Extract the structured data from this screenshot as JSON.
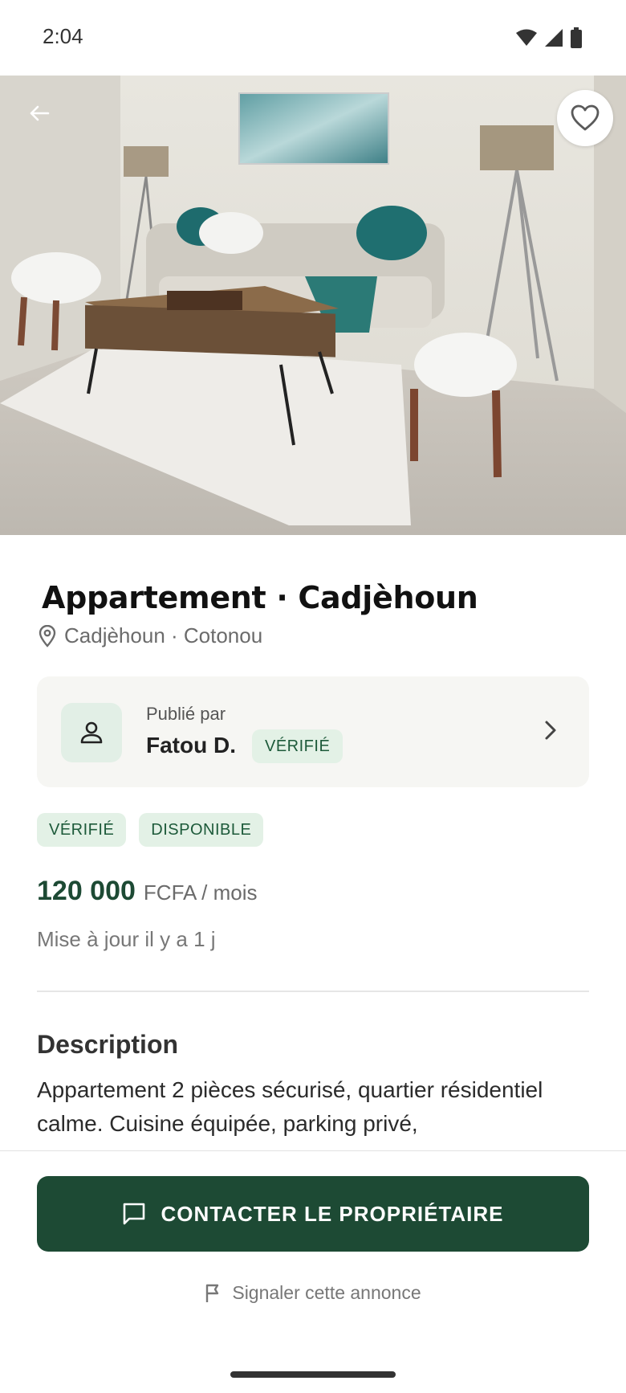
{
  "status_bar": {
    "time": "2:04"
  },
  "listing": {
    "title": "Appartement · Cadjèhoun",
    "location": "Cadjèhoun · Cotonou",
    "owner": {
      "pre_label": "Publié par",
      "name": "Fatou D.",
      "badge": "VÉRIFIÉ"
    },
    "tags": [
      "VÉRIFIÉ",
      "DISPONIBLE"
    ],
    "price_amount": "120 000",
    "price_unit": "FCFA / mois",
    "updated": "Mise à jour il y a 1 j",
    "description_title": "Description",
    "description_text": "Appartement 2 pièces sécurisé, quartier résidentiel calme. Cuisine équipée, parking privé,"
  },
  "actions": {
    "contact_label": "CONTACTER LE PROPRIÉTAIRE",
    "report_label": "Signaler cette annonce"
  },
  "icons": {
    "back": "arrow-left-icon",
    "favorite": "heart-outline-icon",
    "location": "map-pin-icon",
    "user": "user-icon",
    "chevron": "chevron-right-icon",
    "chat": "chat-bubble-icon",
    "flag": "flag-icon"
  },
  "colors": {
    "accent": "#1d4a34",
    "badge_bg": "#e3f1e6",
    "badge_text": "#1d5a3a"
  }
}
